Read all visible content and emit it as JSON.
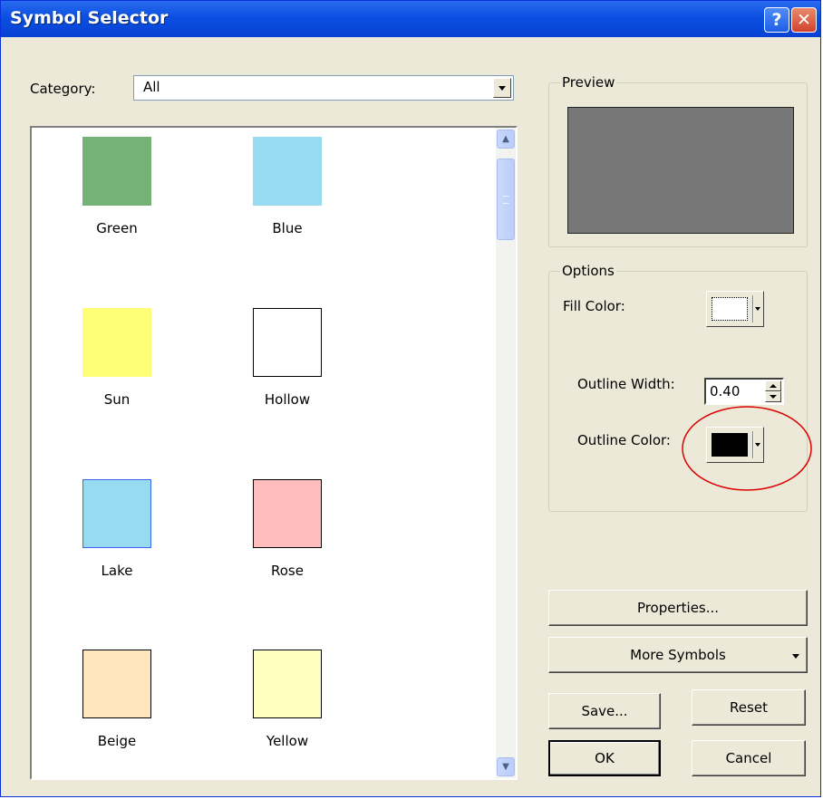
{
  "window": {
    "title": "Symbol Selector",
    "help_glyph": "?",
    "close_glyph": "✕"
  },
  "category": {
    "label": "Category:",
    "selected": "All"
  },
  "symbols": [
    {
      "name": "Green",
      "fill": "#75b275",
      "border": "#75b275"
    },
    {
      "name": "Blue",
      "fill": "#97dbf0",
      "border": "#97dbf0"
    },
    {
      "name": "Sun",
      "fill": "#ffff77",
      "border": "#ffff77"
    },
    {
      "name": "Hollow",
      "fill": "#ffffff",
      "border": "#000000"
    },
    {
      "name": "Lake",
      "fill": "#97dbf0",
      "border": "#3b62f0"
    },
    {
      "name": "Rose",
      "fill": "#ffbdbd",
      "border": "#000000"
    },
    {
      "name": "Beige",
      "fill": "#ffe6bf",
      "border": "#000000"
    },
    {
      "name": "Yellow",
      "fill": "#ffffbf",
      "border": "#000000"
    }
  ],
  "preview": {
    "title": "Preview",
    "fill": "#777777"
  },
  "options": {
    "title": "Options",
    "fill_color_label": "Fill Color:",
    "outline_width_label": "Outline Width:",
    "outline_width_value": "0.40",
    "outline_color_label": "Outline Color:",
    "outline_color": "#000000"
  },
  "buttons": {
    "properties": "Properties...",
    "more_symbols": "More Symbols",
    "save": "Save...",
    "reset": "Reset",
    "ok": "OK",
    "cancel": "Cancel"
  },
  "annotation_color": "#dd0000"
}
